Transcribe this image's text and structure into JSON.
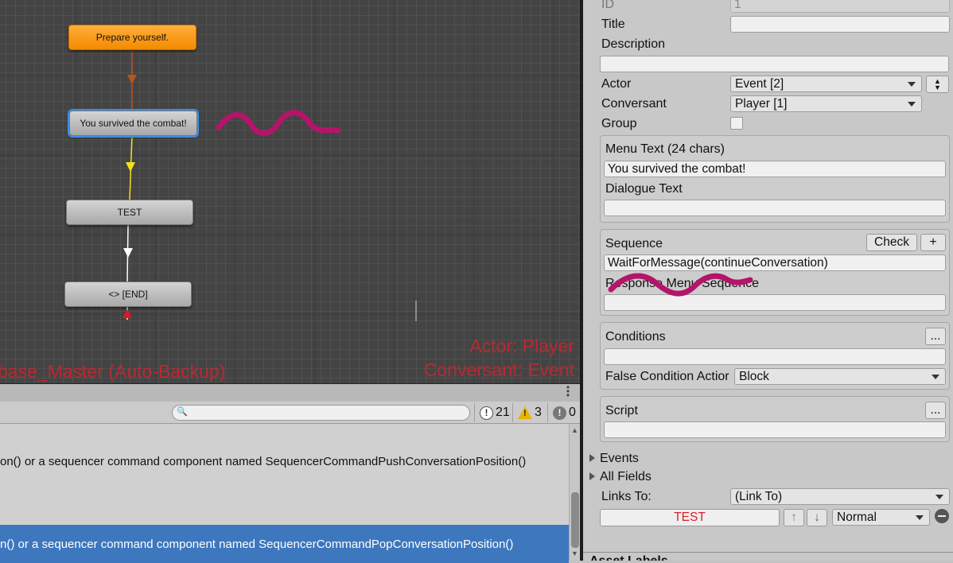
{
  "graph": {
    "nodes": [
      {
        "id": "n1",
        "label": "Prepare yourself."
      },
      {
        "id": "n2",
        "label": "You survived the combat!"
      },
      {
        "id": "n3",
        "label": "TEST"
      },
      {
        "id": "n4",
        "label": "<> [END]"
      }
    ],
    "overlay": {
      "database_label": "base_Master (Auto-Backup)",
      "actor_label": "Actor: Player",
      "conversant_label": "Conversant: Event"
    },
    "colors": {
      "start_node": "#f48a00",
      "link_orange": "#b4561e",
      "link_yellow": "#f5e11a",
      "link_white": "#ffffff",
      "end_marker": "#e8161a",
      "overlay_text": "#d8222e"
    }
  },
  "console": {
    "search": {
      "placeholder": ""
    },
    "counts": {
      "info": "21",
      "warnings": "3",
      "errors": "0"
    },
    "logs": [
      {
        "text": "on() or a sequencer command component named SequencerCommandPushConversationPosition()",
        "selected": false
      },
      {
        "text": "n() or a sequencer command component named SequencerCommandPopConversationPosition()",
        "selected": true
      }
    ]
  },
  "inspector": {
    "id": {
      "label": "ID",
      "value": "1"
    },
    "title": {
      "label": "Title",
      "value": ""
    },
    "description": {
      "label": "Description",
      "value": ""
    },
    "actor": {
      "label": "Actor",
      "value": "Event [2]"
    },
    "conversant": {
      "label": "Conversant",
      "value": "Player [1]"
    },
    "group": {
      "label": "Group",
      "checked": false
    },
    "menu_text": {
      "label": "Menu Text (24 chars)",
      "value": "You survived the combat!"
    },
    "dialogue_text": {
      "label": "Dialogue Text",
      "value": ""
    },
    "sequence": {
      "label": "Sequence",
      "check_label": "Check",
      "add_label": "+",
      "value": "WaitForMessage(continueConversation)"
    },
    "response_menu_sequence": {
      "label": "Response Menu Sequence",
      "value": ""
    },
    "conditions": {
      "label": "Conditions",
      "more_label": "...",
      "value": ""
    },
    "false_condition_action": {
      "label": "False Condition Actior",
      "value": "Block"
    },
    "script": {
      "label": "Script",
      "more_label": "...",
      "value": ""
    },
    "events_label": "Events",
    "all_fields_label": "All Fields",
    "links_to": {
      "label": "Links To:",
      "value": "(Link To)"
    },
    "link_entry": {
      "target": "TEST",
      "priority": "Normal"
    },
    "bottom_label": "Asset Labels"
  }
}
